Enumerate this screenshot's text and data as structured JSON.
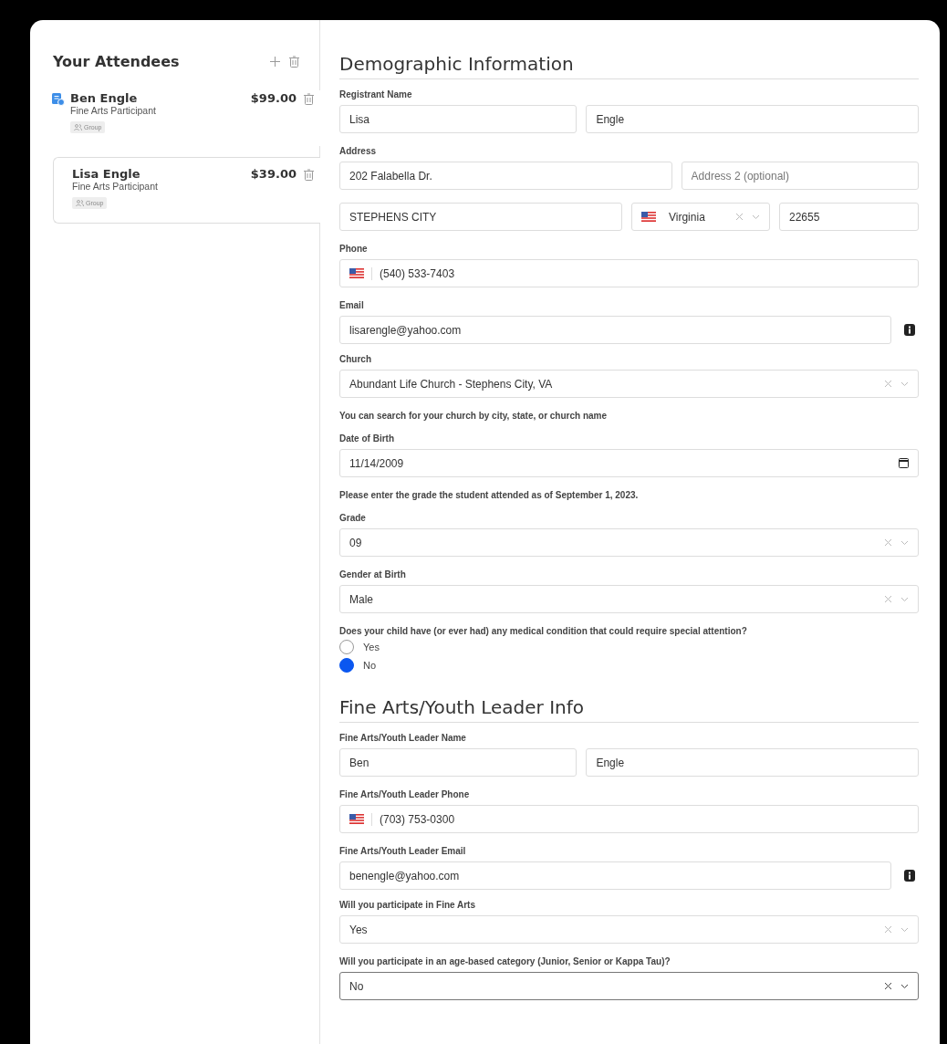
{
  "sidebar": {
    "title": "Your Attendees",
    "attendees": [
      {
        "name": "Ben Engle",
        "role": "Fine Arts Participant",
        "price": "$99.00",
        "tag": "Group",
        "complete": true,
        "selected": false
      },
      {
        "name": "Lisa Engle",
        "role": "Fine Arts Participant",
        "price": "$39.00",
        "tag": "Group",
        "complete": false,
        "selected": true
      }
    ]
  },
  "sections": [
    {
      "title": "Demographic Information",
      "items": [
        {
          "kind": "label",
          "text": "Registrant Name"
        },
        {
          "kind": "name_row",
          "fields": [
            {
              "value": "Lisa"
            },
            {
              "value": "Engle"
            }
          ]
        },
        {
          "kind": "label",
          "text": "Address"
        },
        {
          "kind": "address_row",
          "fields": [
            {
              "value": "202 Falabella Dr."
            },
            {
              "placeholder": "Address 2 (optional)"
            }
          ]
        },
        {
          "kind": "city_row",
          "fields": [
            {
              "value": "STEPHENS CITY"
            },
            {
              "kind": "state",
              "value": "Virginia"
            },
            {
              "value": "22655"
            }
          ]
        },
        {
          "kind": "label",
          "text": "Phone"
        },
        {
          "kind": "phone",
          "value": "(540) 533-7403"
        },
        {
          "kind": "label",
          "text": "Email"
        },
        {
          "kind": "email",
          "value": "lisarengle@yahoo.com"
        },
        {
          "kind": "label",
          "text": "Church"
        },
        {
          "kind": "select",
          "value": "Abundant Life Church - Stephens City, VA",
          "focused": false
        },
        {
          "kind": "note",
          "text": "You can search for your church by city, state, or church name"
        },
        {
          "kind": "label",
          "text": "Date of Birth"
        },
        {
          "kind": "date",
          "value": "11/14/2009"
        },
        {
          "kind": "note",
          "text": "Please enter the grade the student attended as of September 1, 2023."
        },
        {
          "kind": "label",
          "text": "Grade"
        },
        {
          "kind": "select",
          "value": "09",
          "focused": false
        },
        {
          "kind": "label",
          "text": "Gender at Birth"
        },
        {
          "kind": "select",
          "value": "Male",
          "focused": false
        },
        {
          "kind": "label",
          "text": "Does your child have (or ever had) any medical condition that could require special attention?"
        },
        {
          "kind": "radio",
          "options": [
            {
              "label": "Yes",
              "selected": false
            },
            {
              "label": "No",
              "selected": true
            }
          ]
        }
      ]
    },
    {
      "title": "Fine Arts/Youth Leader Info",
      "items": [
        {
          "kind": "label",
          "text": "Fine Arts/Youth Leader Name"
        },
        {
          "kind": "name_row",
          "fields": [
            {
              "value": "Ben"
            },
            {
              "value": "Engle"
            }
          ]
        },
        {
          "kind": "label",
          "text": "Fine Arts/Youth Leader Phone"
        },
        {
          "kind": "phone",
          "value": "(703) 753-0300"
        },
        {
          "kind": "label",
          "text": "Fine Arts/Youth Leader Email"
        },
        {
          "kind": "email",
          "value": "benengle@yahoo.com"
        },
        {
          "kind": "label",
          "text": "Will you participate in Fine Arts"
        },
        {
          "kind": "select",
          "value": "Yes",
          "focused": false
        },
        {
          "kind": "label",
          "text": "Will you participate in an age-based category (Junior, Senior or Kappa Tau)?"
        },
        {
          "kind": "select",
          "value": "No",
          "focused": true
        }
      ]
    }
  ]
}
